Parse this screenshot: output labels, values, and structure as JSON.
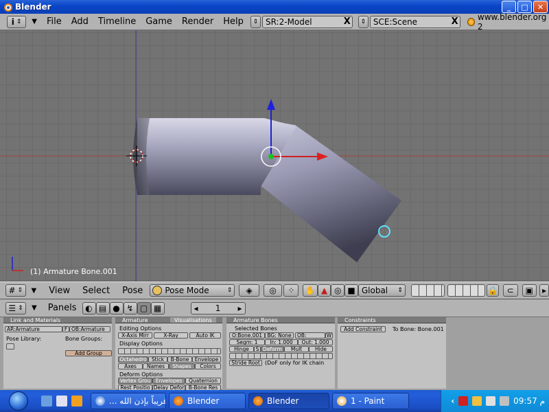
{
  "window": {
    "title": "Blender",
    "min": "_",
    "max": "□",
    "close": "✕"
  },
  "topmenu": {
    "items": [
      "File",
      "Add",
      "Timeline",
      "Game",
      "Render",
      "Help"
    ],
    "screen_field": "SR:2-Model",
    "scene_field": "SCE:Scene",
    "url": "www.blender.org 2",
    "field_close": "X"
  },
  "viewport": {
    "status_text": "(1) Armature Bone.001"
  },
  "vpheader": {
    "items": [
      "View",
      "Select",
      "Pose"
    ],
    "mode": "Pose Mode",
    "orientation": "Global"
  },
  "btnheader": {
    "panels_label": "Panels",
    "frame_value": "1"
  },
  "panels": {
    "link_materials": {
      "tab": "Link and Materials",
      "armature_field": "AR:Armature",
      "f_label": "F",
      "object_field": "OB:Armature",
      "pose_library": "Pose Library:",
      "bone_groups": "Bone Groups:",
      "add_group": "Add Group"
    },
    "armature": {
      "tab": "Armature",
      "tab2": "Visualisations",
      "editing_options": "Editing Options",
      "x_axis_mirror": "X-Axis Mirr",
      "x_ray": "X-Ray",
      "auto_ik": "Auto IK",
      "display_options": "Display Options",
      "octahedron": "Octahedro",
      "stick": "Stick",
      "bbone": "B-Bone",
      "envelope": "Envelope",
      "axes": "Axes",
      "names": "Names",
      "shapes": "Shapes",
      "colors": "Colors",
      "deform_options": "Deform Options",
      "vertex_groups": "Vertex Grou",
      "envelopes": "Envelopes",
      "quaternion": "Quaternion",
      "rest_position": "Rest Positio",
      "delay_deform": "Delay Defor",
      "bbone_rest": "B-Bone Res"
    },
    "armature_bones": {
      "tab": "Armature Bones",
      "selected_bones": "Selected Bones",
      "bone_field": "O:Bone.001",
      "bg_field": "BG: None",
      "ob_field": "OB:",
      "w_label": "W",
      "segm": "Segm: 1",
      "in": "In: 1.000",
      "out": "Out: 1.000",
      "hinge": "Hinge",
      "s": "S",
      "deform": "Deform",
      "mult": "Mult",
      "hide": "Hide",
      "stride_root": "Stride Root",
      "dof_note": "(DoF only for IK chain"
    },
    "constraints": {
      "tab": "Constraints",
      "add_constraint": "Add Constraint",
      "to_bone": "To Bone: Bone.001"
    }
  },
  "taskbar": {
    "tasks": [
      "... قريباً بإذن الله",
      "Blender",
      "Blender",
      "1 - Paint"
    ],
    "clock": "09:57 م"
  }
}
